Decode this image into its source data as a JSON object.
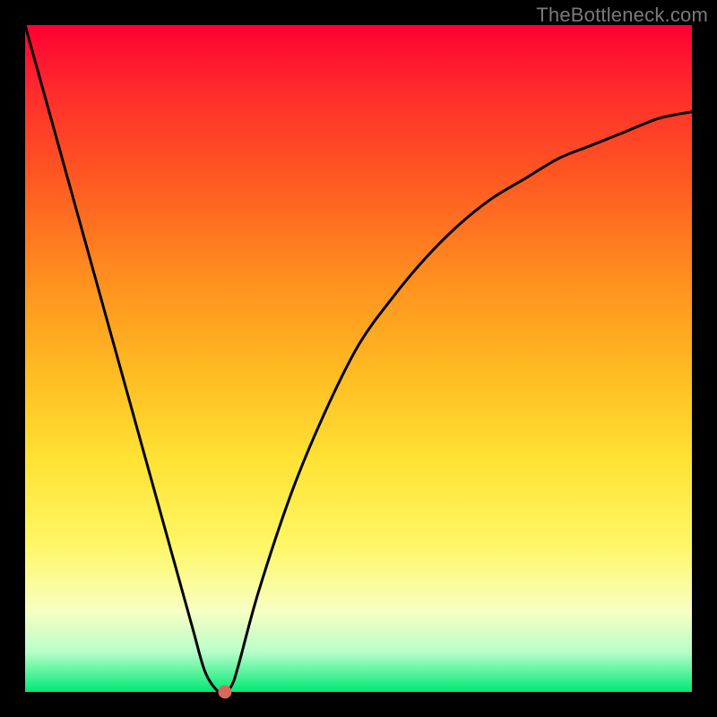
{
  "watermark": "TheBottleneck.com",
  "chart_data": {
    "type": "line",
    "title": "",
    "xlabel": "",
    "ylabel": "",
    "xlim": [
      0,
      100
    ],
    "ylim": [
      0,
      100
    ],
    "series": [
      {
        "name": "bottleneck-curve",
        "x": [
          0,
          5,
          10,
          15,
          20,
          25,
          27,
          29,
          30,
          31,
          32,
          35,
          40,
          45,
          50,
          55,
          60,
          65,
          70,
          75,
          80,
          85,
          90,
          95,
          100
        ],
        "values": [
          100,
          82,
          64,
          46,
          28,
          10,
          3,
          0,
          0,
          1,
          4,
          15,
          30,
          42,
          52,
          59,
          65,
          70,
          74,
          77,
          80,
          82,
          84,
          86,
          87
        ]
      }
    ],
    "marker": {
      "x": 30,
      "y": 0
    },
    "gradient_stops": [
      {
        "pos": 0,
        "color": "#ff0033"
      },
      {
        "pos": 10,
        "color": "#ff2c2c"
      },
      {
        "pos": 22,
        "color": "#ff5522"
      },
      {
        "pos": 38,
        "color": "#ff8f1f"
      },
      {
        "pos": 52,
        "color": "#ffbb22"
      },
      {
        "pos": 65,
        "color": "#ffe233"
      },
      {
        "pos": 78,
        "color": "#fff766"
      },
      {
        "pos": 88,
        "color": "#f7ffc4"
      },
      {
        "pos": 94,
        "color": "#b7ffc9"
      },
      {
        "pos": 100,
        "color": "#00e874"
      }
    ]
  }
}
